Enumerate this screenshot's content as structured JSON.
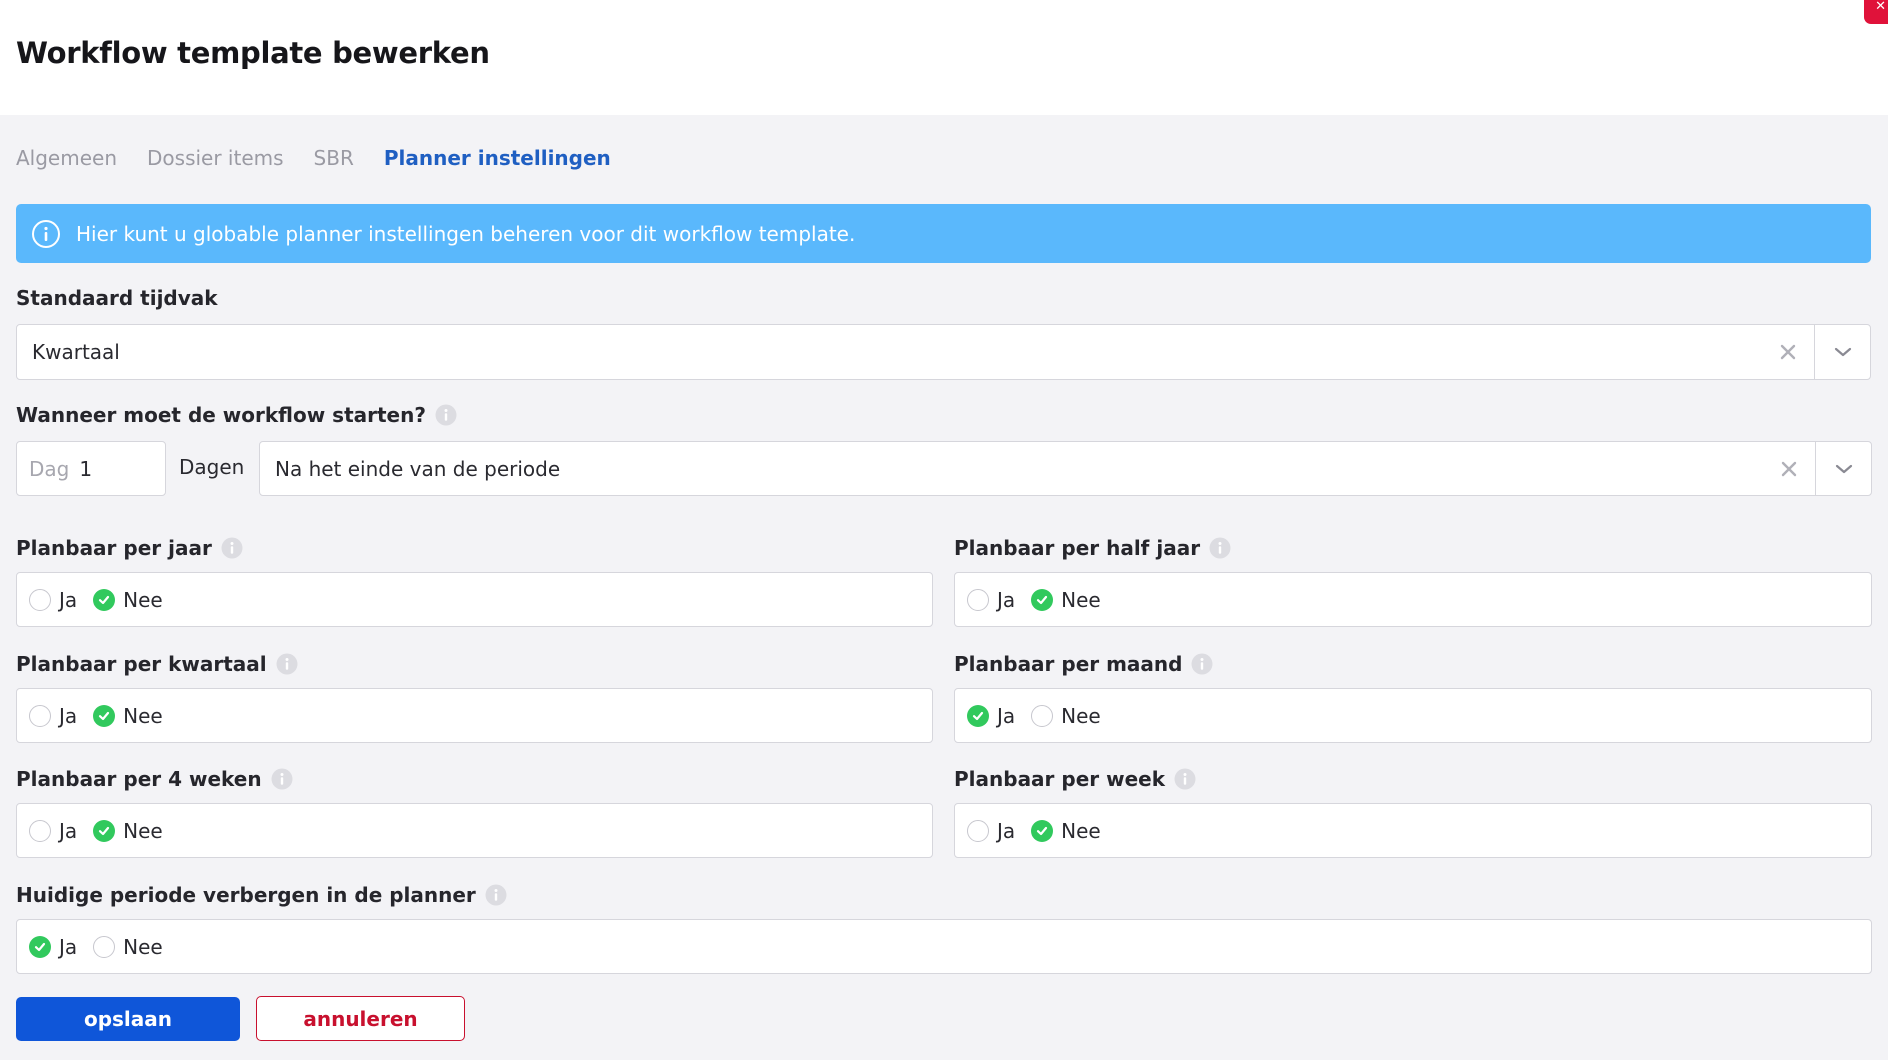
{
  "page": {
    "title": "Workflow template bewerken"
  },
  "tabs": [
    {
      "label": "Algemeen",
      "active": false
    },
    {
      "label": "Dossier items",
      "active": false
    },
    {
      "label": "SBR",
      "active": false
    },
    {
      "label": "Planner instellingen",
      "active": true
    }
  ],
  "info_banner": {
    "text": "Hier kunt u globable planner instellingen beheren voor dit workflow template.",
    "icon": "info-icon"
  },
  "standaard_tijdvak": {
    "label": "Standaard tijdvak",
    "value": "Kwartaal"
  },
  "start": {
    "label": "Wanneer moet de workflow starten?",
    "day_prefix": "Dag",
    "day_value": "1",
    "dagen_label": "Dagen",
    "moment_value": "Na het einde van de periode"
  },
  "options": {
    "yes": "Ja",
    "no": "Nee"
  },
  "settings": {
    "jaar": {
      "label": "Planbaar per jaar",
      "selected": "Nee"
    },
    "half_jaar": {
      "label": "Planbaar per half jaar",
      "selected": "Nee"
    },
    "kwartaal": {
      "label": "Planbaar per kwartaal",
      "selected": "Nee"
    },
    "maand": {
      "label": "Planbaar per maand",
      "selected": "Ja"
    },
    "vier_weken": {
      "label": "Planbaar per 4 weken",
      "selected": "Nee"
    },
    "week": {
      "label": "Planbaar per week",
      "selected": "Nee"
    },
    "verbergen": {
      "label": "Huidige periode verbergen in de planner",
      "selected": "Ja"
    }
  },
  "buttons": {
    "save": "opslaan",
    "cancel": "annuleren"
  },
  "colors": {
    "primary": "#0f56d9",
    "danger": "#c8102e",
    "info": "#5ab8fc",
    "check": "#31c95d",
    "active_tab": "#1f5fc2"
  }
}
